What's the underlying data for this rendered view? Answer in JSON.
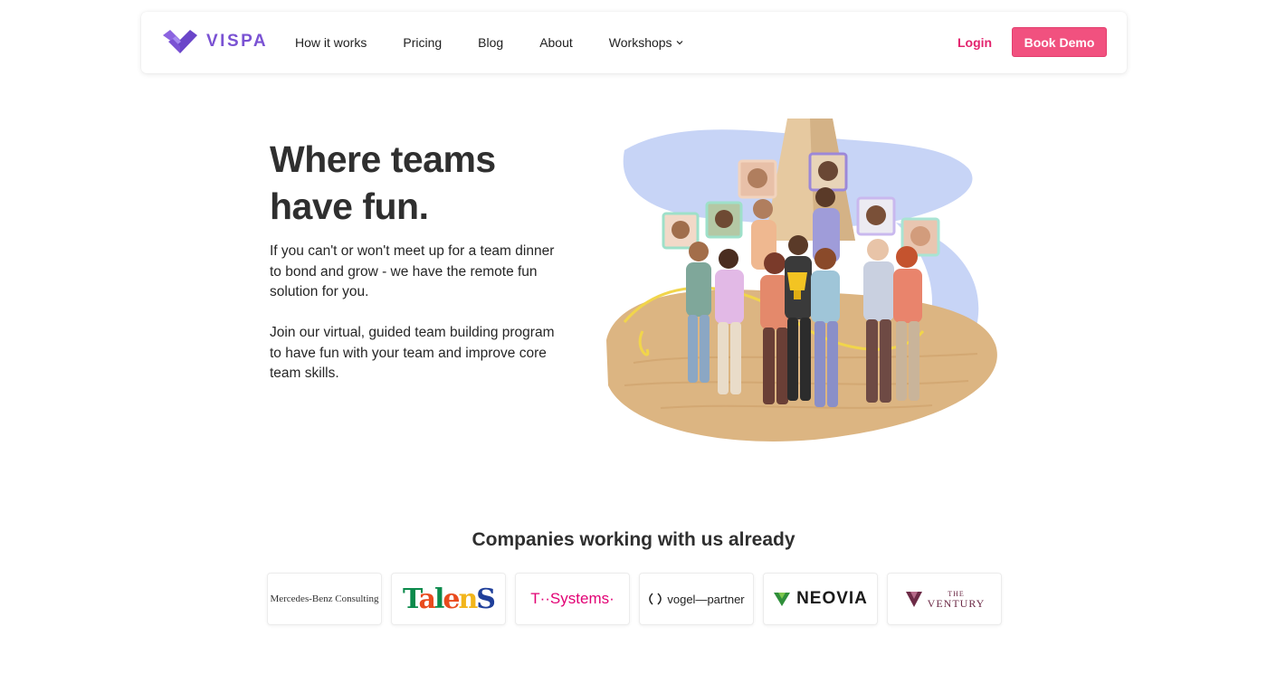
{
  "brand": {
    "name": "VISPA",
    "color": "#7a52d3",
    "accent": "#f1517f"
  },
  "nav": {
    "links": [
      "How it works",
      "Pricing",
      "Blog",
      "About",
      "Workshops"
    ],
    "login": "Login",
    "cta": "Book Demo"
  },
  "hero": {
    "title": "Where teams have fun.",
    "paragraph1": "If you can't or won't meet up for a team dinner to bond and grow - we have the remote fun solution for you.",
    "paragraph2": "Join our virtual, guided team building program to have fun with your team and improve core team skills.",
    "illustration": "team-avatars-desert-illustration"
  },
  "companies": {
    "title": "Companies working with us already",
    "logos": [
      {
        "name": "Mercedes-Benz Consulting",
        "text": "Mercedes-Benz Consulting"
      },
      {
        "name": "Talents",
        "text": "Talents"
      },
      {
        "name": "T-Systems",
        "text": "T··Systems·"
      },
      {
        "name": "vogel partner",
        "text": "vogel—partner"
      },
      {
        "name": "NEOVIA",
        "text": "NEOVIA"
      },
      {
        "name": "The Ventury",
        "text": "VENTURY",
        "prefix": "THE"
      }
    ]
  }
}
